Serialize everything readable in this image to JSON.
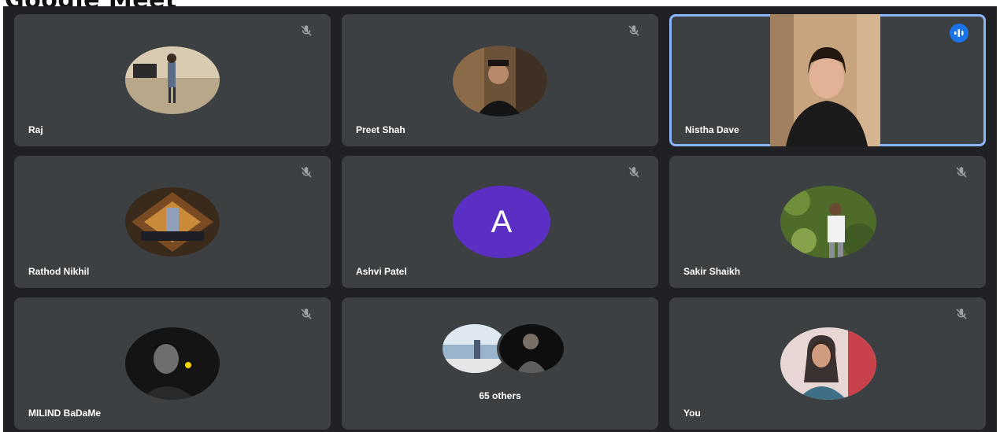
{
  "page": {
    "cut_title": "Google Meet"
  },
  "participants": [
    {
      "name": "Raj",
      "muted": true
    },
    {
      "name": "Preet Shah",
      "muted": true
    },
    {
      "name": "Nistha Dave",
      "muted": false,
      "speaking": true,
      "video_on": true
    },
    {
      "name": "Rathod Nikhil",
      "muted": true
    },
    {
      "name": "Ashvi Patel",
      "muted": true,
      "initial": "A",
      "avatar_color": "#5b2fc4"
    },
    {
      "name": "Sakir Shaikh",
      "muted": true
    },
    {
      "name": "MILIND BaDaMe",
      "muted": true
    },
    {
      "name": "You",
      "muted": true
    }
  ],
  "others": {
    "label": "65 others"
  },
  "icons": {
    "mute": "mic-off-icon",
    "speaking": "audio-level-icon"
  },
  "colors": {
    "tile": "#3c4043",
    "background": "#202124",
    "active_border": "#8ab4f8",
    "speaking_badge": "#1a73e8"
  }
}
